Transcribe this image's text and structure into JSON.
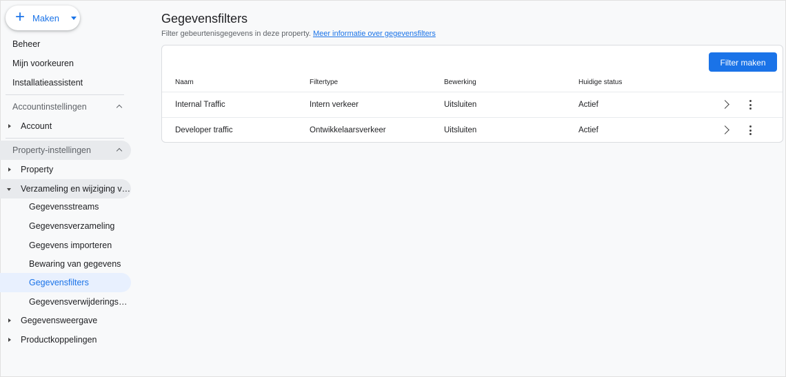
{
  "sidebar": {
    "create_button": {
      "label": "Maken"
    },
    "top_items": [
      {
        "label": "Beheer"
      },
      {
        "label": "Mijn voorkeuren"
      },
      {
        "label": "Installatieassistent"
      }
    ],
    "account_section": {
      "label": "Accountinstellingen",
      "items": [
        {
          "label": "Account"
        }
      ]
    },
    "property_section": {
      "label": "Property-instellingen",
      "property_item": {
        "label": "Property"
      },
      "collection": {
        "label": "Verzameling en wijziging van gegevens",
        "children": [
          {
            "label": "Gegevensstreams"
          },
          {
            "label": "Gegevensverzameling"
          },
          {
            "label": "Gegevens importeren"
          },
          {
            "label": "Bewaring van gegevens"
          },
          {
            "label": "Gegevensfilters",
            "active": true
          },
          {
            "label": "Gegevensverwijderingsverzoeken"
          }
        ]
      },
      "more_items": [
        {
          "label": "Gegevensweergave"
        },
        {
          "label": "Productkoppelingen"
        }
      ]
    }
  },
  "main": {
    "title": "Gegevensfilters",
    "subtitle": "Filter gebeurtenisgegevens in deze property.",
    "subtitle_link": "Meer informatie over gegevensfilters",
    "create_filter_label": "Filter maken",
    "table": {
      "headers": [
        "Naam",
        "Filtertype",
        "Bewerking",
        "Huidige status"
      ],
      "rows": [
        {
          "name": "Internal Traffic",
          "type": "Intern verkeer",
          "operation": "Uitsluiten",
          "status": "Actief"
        },
        {
          "name": "Developer traffic",
          "type": "Ontwikkelaarsverkeer",
          "operation": "Uitsluiten",
          "status": "Actief"
        }
      ]
    }
  },
  "colors": {
    "accent": "#1a73e8",
    "active_bg": "#e8f0fe",
    "shaded_bg": "#e8eaed",
    "page_bg": "#f8f9fa"
  },
  "icons": [
    "plus-icon",
    "caret-down-icon",
    "chevron-up-icon",
    "triangle-right-icon",
    "triangle-down-icon",
    "chevron-right-icon",
    "more-vert-icon"
  ]
}
